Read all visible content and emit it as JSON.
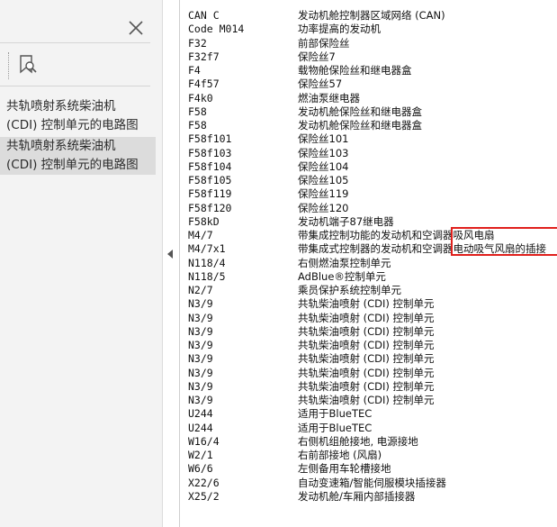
{
  "sidebar": {
    "items": [
      {
        "label_line1": "共轨喷射系统柴油机",
        "label_line2": "(CDI) 控制单元的电路图"
      },
      {
        "label_line1": "共轨喷射系统柴油机",
        "label_line2": "(CDI) 控制单元的电路图"
      }
    ],
    "close_icon": "close-icon",
    "bookmark_icon": "bookmark-search-icon"
  },
  "table": {
    "rows": [
      {
        "code": "CAN C",
        "desc": "发动机舱控制器区域网络 (CAN)"
      },
      {
        "code": "Code M014",
        "desc": "功率提高的发动机"
      },
      {
        "code": "F32",
        "desc": "前部保险丝"
      },
      {
        "code": "F32f7",
        "desc": "保险丝7"
      },
      {
        "code": "F4",
        "desc": "载物舱保险丝和继电器盒"
      },
      {
        "code": "F4f57",
        "desc": "保险丝57"
      },
      {
        "code": "F4k0",
        "desc": "燃油泵继电器"
      },
      {
        "code": "F58",
        "desc": "发动机舱保险丝和继电器盒"
      },
      {
        "code": "F58",
        "desc": "发动机舱保险丝和继电器盒"
      },
      {
        "code": "F58f101",
        "desc": "保险丝101"
      },
      {
        "code": "F58f103",
        "desc": "保险丝103"
      },
      {
        "code": "F58f104",
        "desc": "保险丝104"
      },
      {
        "code": "F58f105",
        "desc": "保险丝105"
      },
      {
        "code": "F58f119",
        "desc": "保险丝119"
      },
      {
        "code": "F58f120",
        "desc": "保险丝120"
      },
      {
        "code": "F58kD",
        "desc": "发动机端子87继电器"
      },
      {
        "code": "M4/7",
        "desc": "带集成控制功能的发动机和空调器吸风电扇"
      },
      {
        "code": "M4/7x1",
        "desc": "带集成式控制器的发动机和空调器电动吸气风扇的插接"
      },
      {
        "code": "N118/4",
        "desc": "右侧燃油泵控制单元"
      },
      {
        "code": "N118/5",
        "desc": "AdBlue®控制单元"
      },
      {
        "code": "N2/7",
        "desc": "乘员保护系统控制单元"
      },
      {
        "code": "N3/9",
        "desc": "共轨柴油喷射 (CDI) 控制单元"
      },
      {
        "code": "N3/9",
        "desc": "共轨柴油喷射 (CDI) 控制单元"
      },
      {
        "code": "N3/9",
        "desc": "共轨柴油喷射 (CDI) 控制单元"
      },
      {
        "code": "N3/9",
        "desc": "共轨柴油喷射 (CDI) 控制单元"
      },
      {
        "code": "N3/9",
        "desc": "共轨柴油喷射 (CDI) 控制单元"
      },
      {
        "code": "N3/9",
        "desc": "共轨柴油喷射 (CDI) 控制单元"
      },
      {
        "code": "N3/9",
        "desc": "共轨柴油喷射 (CDI) 控制单元"
      },
      {
        "code": "N3/9",
        "desc": "共轨柴油喷射 (CDI) 控制单元"
      },
      {
        "code": "U244",
        "desc": "适用于BlueTEC"
      },
      {
        "code": "U244",
        "desc": "适用于BlueTEC"
      },
      {
        "code": "W16/4",
        "desc": "右侧机组舱接地, 电源接地"
      },
      {
        "code": "W2/1",
        "desc": "右前部接地 (风扇)"
      },
      {
        "code": "W6/6",
        "desc": "左侧备用车轮槽接地"
      },
      {
        "code": "X22/6",
        "desc": "自动变速箱/智能伺服模块插接器"
      },
      {
        "code": "X25/2",
        "desc": "发动机舱/车厢内部插接器"
      }
    ]
  },
  "colors": {
    "highlight_border": "#e0201c",
    "sidebar_bg": "#f3f3f3",
    "selected_bg": "#dcdcdc"
  }
}
